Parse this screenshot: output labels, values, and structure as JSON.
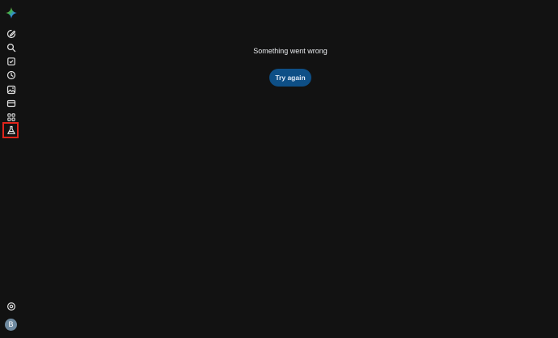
{
  "sidebar": {
    "logo": "gemini-sparkle-icon",
    "items": [
      {
        "icon": "edit-icon"
      },
      {
        "icon": "search-icon"
      },
      {
        "icon": "task-checkbox-icon"
      },
      {
        "icon": "history-clock-icon"
      },
      {
        "icon": "image-gallery-icon"
      },
      {
        "icon": "video-icon"
      },
      {
        "icon": "apps-grid-icon"
      },
      {
        "icon": "labs-flask-icon",
        "selected": true
      }
    ],
    "settings_icon": "settings-gear-icon",
    "avatar_letter": "B",
    "selection_color": "#e1251b"
  },
  "main": {
    "error_message": "Something went wrong",
    "retry_label": "Try again",
    "retry_color": "#0e4f86"
  },
  "theme": {
    "background": "#121212",
    "icon_color": "#e3e3e3"
  }
}
